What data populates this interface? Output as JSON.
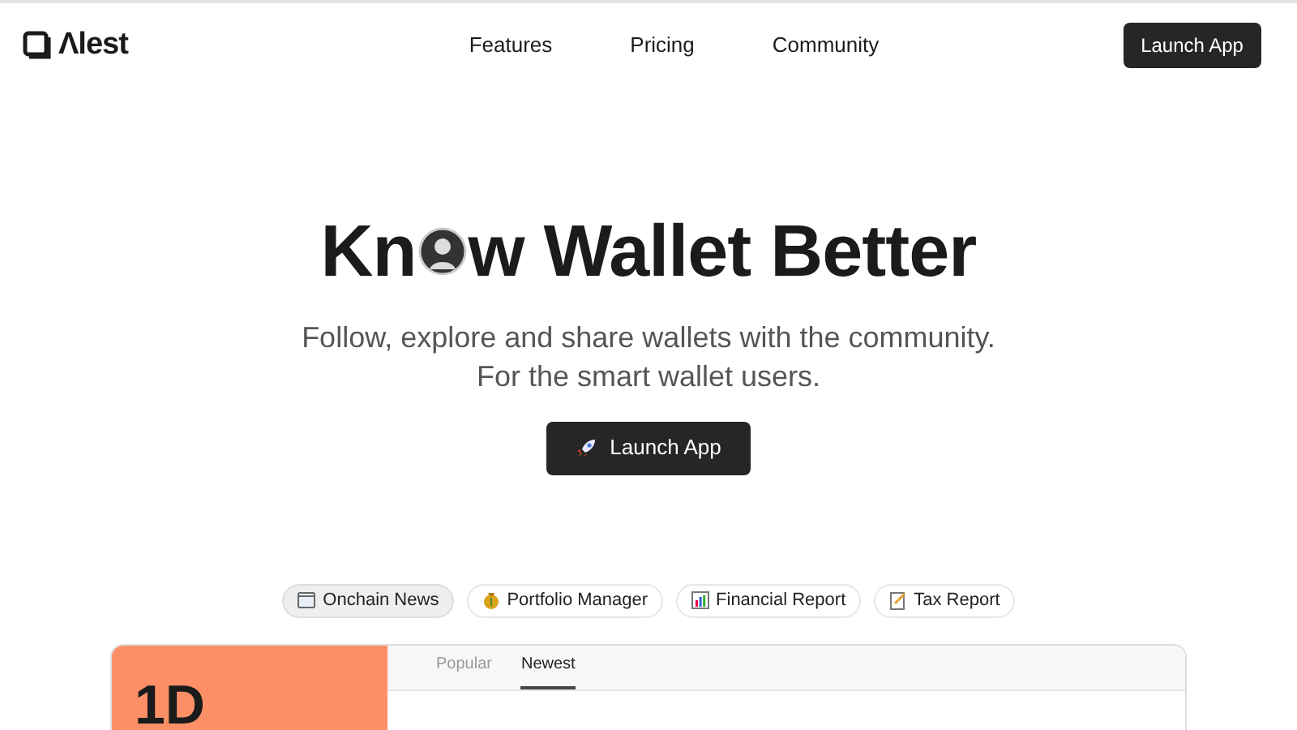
{
  "header": {
    "logo": "Λlest",
    "nav": [
      "Features",
      "Pricing",
      "Community"
    ],
    "button": "Launch App"
  },
  "hero": {
    "title_start": "Kn",
    "title_end": "w Wallet Better",
    "subtitle": [
      "Follow, explore and share wallets with the community.",
      "For the smart wallet users."
    ],
    "button": "Launch App"
  },
  "chips": [
    {
      "label": "Onchain News",
      "selected": true,
      "kind": "news"
    },
    {
      "label": "Portfolio Manager",
      "selected": false,
      "kind": "money"
    },
    {
      "label": "Financial Report",
      "selected": false,
      "kind": "chart"
    },
    {
      "label": "Tax Report",
      "selected": false,
      "kind": "memo"
    }
  ],
  "preview": {
    "period": "1D",
    "tabs": [
      {
        "label": "Popular",
        "selected": false
      },
      {
        "label": "Newest",
        "selected": true
      }
    ]
  }
}
